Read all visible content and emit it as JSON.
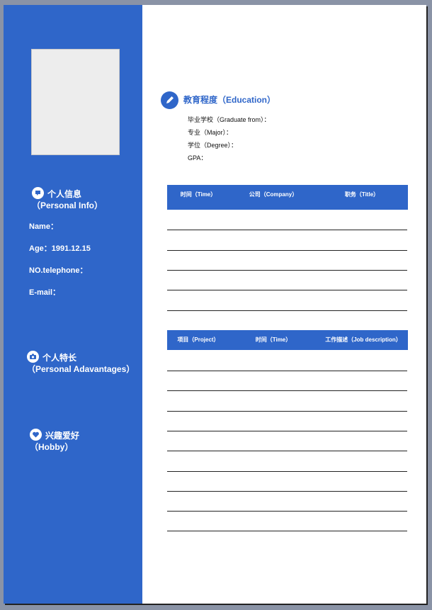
{
  "sidebar": {
    "personal_info": {
      "title_cn": "个人信息",
      "title_en": "（Personal Info）",
      "icon": "chat-bubble-icon",
      "fields": [
        "Name：",
        "Age：1991.12.15",
        "NO.telephone：",
        "E-mail："
      ]
    },
    "advantages": {
      "title_cn": "个人特长",
      "title_en": "（Personal Adavantages）",
      "icon": "camera-icon"
    },
    "hobby": {
      "title_cn": "兴趣爱好",
      "title_en": "（Hobby）",
      "icon": "heart-icon"
    }
  },
  "education": {
    "title": "教育程度（Education）",
    "icon": "pencil-icon",
    "fields": [
      "毕业学校（Graduate from）：",
      "专业（Major）：",
      "学位（Degree）：",
      "GPA："
    ]
  },
  "work_table": {
    "headers": [
      "时间（Time）",
      "公司（Company）",
      "职务（Title）"
    ]
  },
  "project_table": {
    "headers": [
      "项目（Project）",
      "时间（Time）",
      "工作描述（Job description）"
    ]
  },
  "colors": {
    "accent": "#2f66c9",
    "photo": "#ededed",
    "frame": "#8a93a6"
  }
}
